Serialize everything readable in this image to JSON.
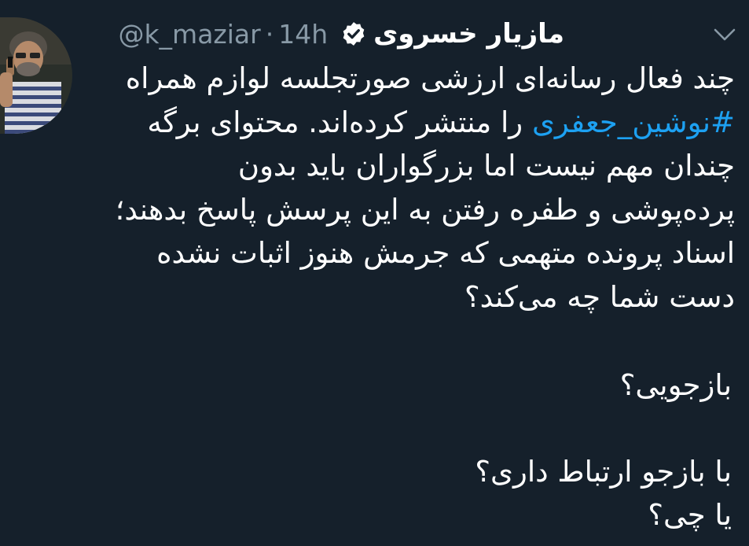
{
  "tweet": {
    "display_name": "مازیار خسروی",
    "handle": "@k_maziar",
    "separator": "·",
    "time": "14h",
    "verified": true,
    "more_icon": "chevron-down-icon",
    "avatar_icon": "profile-photo",
    "lines": {
      "l1": "چند فعال رسانه‌ای ارزشی صورتجلسه لوازم همراه",
      "l2_hashtag": "#نوشین_جعفری",
      "l2_rest": " را منتشر کرده‌اند. محتوای برگه",
      "l3": "چندان مهم نیست اما بزرگواران باید بدون",
      "l4": "پرده‌پوشی و طفره رفتن به این پرسش پاسخ بدهند؛",
      "l5": "اسناد پرونده متهمی که جرمش هنوز اثبات نشده",
      "l6": "دست شما چه می‌کند؟",
      "q1": "بازجویی؟",
      "q2": "با بازجو ارتباط داری؟",
      "q3": "یا چی؟"
    },
    "colors": {
      "background": "#15202b",
      "text": "#ffffff",
      "secondary": "#8899a6",
      "link": "#1da1f2"
    }
  }
}
